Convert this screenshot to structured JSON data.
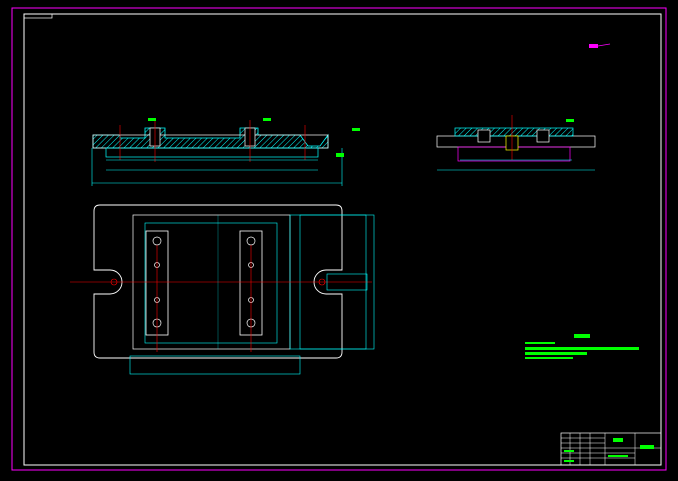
{
  "drawing": {
    "type": "cad-engineering-drawing",
    "colors": {
      "background": "#000000",
      "frame": "#ff00ff",
      "outline": "#ffffff",
      "dimension": "#00ffff",
      "centerline": "#ff0000",
      "section": "#00ffff",
      "annotation": "#00ff00",
      "highlight": "#ff00ff"
    },
    "views": [
      "front-section-view",
      "side-section-view",
      "top-plan-view"
    ],
    "title_block": {
      "cells": 6
    }
  }
}
